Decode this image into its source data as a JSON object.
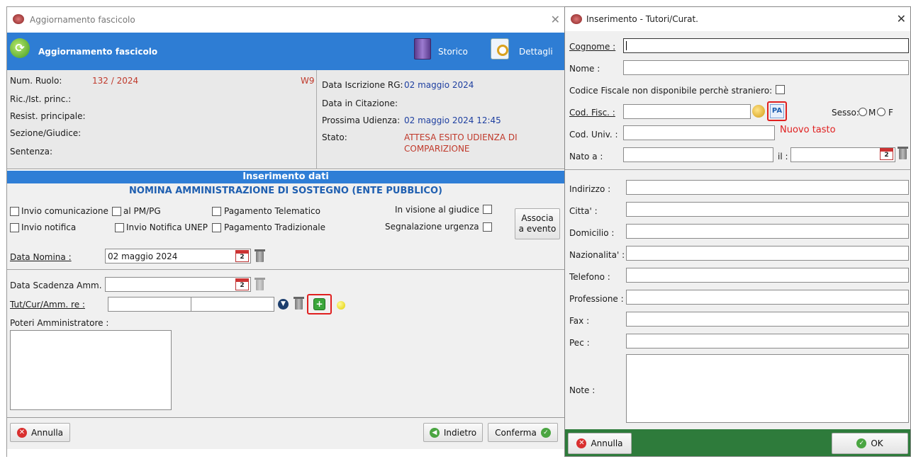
{
  "left": {
    "title": "Aggiornamento fascicolo",
    "header": {
      "title": "Aggiornamento fascicolo",
      "storico": "Storico",
      "dettagli": "Dettagli"
    },
    "info": {
      "num_ruolo_label": "Num. Ruolo:",
      "num_ruolo_value": "132 / 2024",
      "code": "W9",
      "ric_label": "Ric./Ist. princ.:",
      "resist_label": "Resist. principale:",
      "sezione_label": "Sezione/Giudice:",
      "sentenza_label": "Sentenza:",
      "iscrizione_label": "Data Iscrizione RG:",
      "iscrizione_value": "02 maggio 2024",
      "citazione_label": "Data in Citazione:",
      "udienza_label": "Prossima Udienza:",
      "udienza_value": "02 maggio 2024 12:45",
      "stato_label": "Stato:",
      "stato_line1": "ATTESA ESITO UDIENZA DI",
      "stato_line2": "COMPARIZIONE"
    },
    "section_title": "Inserimento dati",
    "subtitle": "NOMINA AMMINISTRAZIONE DI SOSTEGNO (ENTE PUBBLICO)",
    "checks": {
      "invio_comunicazione": "Invio comunicazione",
      "al_pm": "al PM/PG",
      "pag_telematico": "Pagamento Telematico",
      "in_visione": "In visione al giudice",
      "invio_notifica": "Invio notifica",
      "invio_unep": "Invio Notifica UNEP",
      "pag_tradizionale": "Pagamento Tradizionale",
      "segnalazione": "Segnalazione urgenza"
    },
    "associa_line1": "Associa",
    "associa_line2": "a evento",
    "data_nomina_label": "Data Nomina :",
    "data_nomina_value": "02 maggio 2024",
    "cal_day": "2",
    "data_scadenza_label": "Data Scadenza Amm. :",
    "tut_label": "Tut/Cur/Amm. re :",
    "poteri_label": "Poteri Amministratore :",
    "annulla": "Annulla",
    "indietro": "Indietro",
    "conferma": "Conferma"
  },
  "right": {
    "title": "Inserimento - Tutori/Curat.",
    "cognome_label": "Cognome :",
    "nome_label": "Nome :",
    "cf_non_disp_label": "Codice Fiscale non disponibile perchè straniero:",
    "cod_fisc_label": "Cod. Fisc. :",
    "pa_button": "PA",
    "sesso_label": "Sesso:",
    "sesso_m": "M",
    "sesso_f": "F",
    "cod_univ_label": "Cod. Univ. :",
    "nuovo_tasto": "Nuovo tasto",
    "nato_label": "Nato a :",
    "il_label": "il :",
    "cal_day": "2",
    "indirizzo_label": "Indirizzo :",
    "citta_label": "Citta' :",
    "domicilio_label": "Domicilio :",
    "nazionalita_label": "Nazionalita' :",
    "telefono_label": "Telefono :",
    "professione_label": "Professione :",
    "fax_label": "Fax :",
    "pec_label": "Pec :",
    "note_label": "Note :",
    "annulla": "Annulla",
    "ok": "OK"
  },
  "colors": {
    "header_blue": "#2e7dd4",
    "section_blue": "#2f7ed6",
    "subtitle_blue": "#1f5fb0",
    "red_text": "#c0392b",
    "blue_value": "#1e3fa0",
    "footer_green": "#2e7b3b",
    "highlight_red": "#e02020"
  }
}
